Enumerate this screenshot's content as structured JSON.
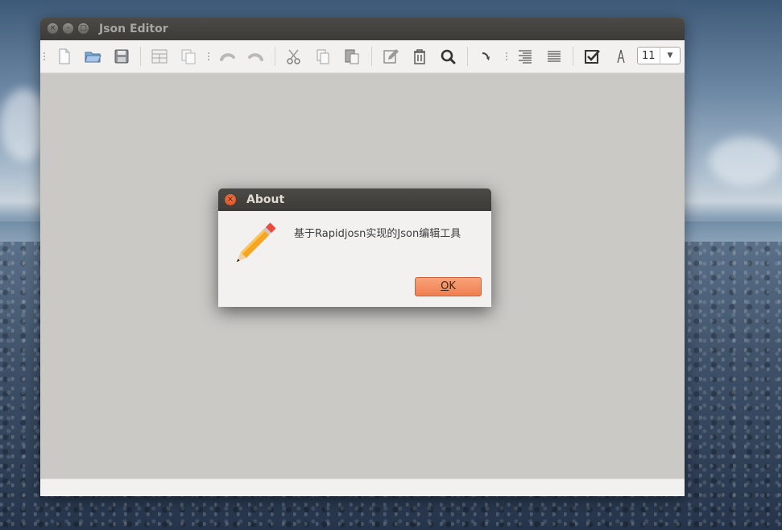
{
  "window": {
    "title": "Json Editor"
  },
  "toolbar": {
    "font_size": "11",
    "tools": [
      "new-file",
      "open-folder",
      "save",
      "table-view",
      "copy-pages",
      "undo",
      "redo",
      "cut",
      "copy",
      "paste",
      "edit",
      "delete",
      "search",
      "indent",
      "align-right",
      "align-justify",
      "checkbox",
      "font"
    ]
  },
  "dialog": {
    "title": "About",
    "message": "基于Rapidjosn实现的Json编辑工具",
    "ok_label_prefix": "",
    "ok_label_mnemonic": "O",
    "ok_label_suffix": "K",
    "close_glyph": "×"
  }
}
